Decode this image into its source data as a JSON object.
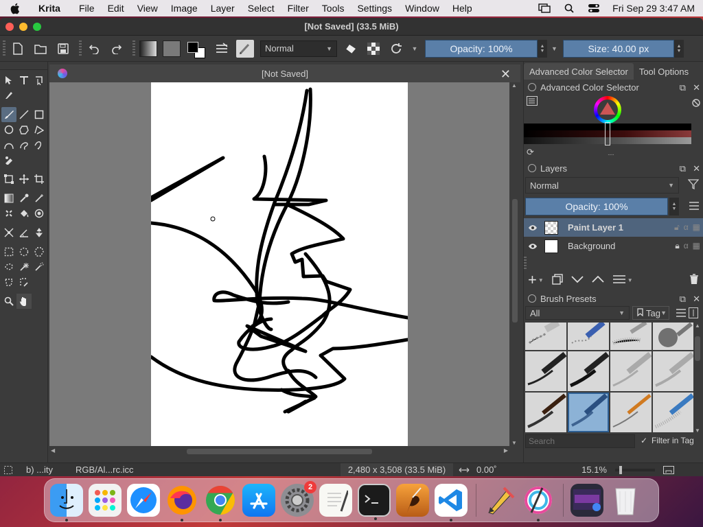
{
  "menubar": {
    "app_name": "Krita",
    "items": [
      "File",
      "Edit",
      "View",
      "Image",
      "Layer",
      "Select",
      "Filter",
      "Tools",
      "Settings",
      "Window",
      "Help"
    ],
    "clock": "Fri Sep 29  3:47 AM"
  },
  "window": {
    "title": "[Not Saved]  (33.5 MiB)"
  },
  "toolbar": {
    "blend_mode": "Normal",
    "opacity": "Opacity: 100%",
    "size": "Size: 40.00 px"
  },
  "document": {
    "tab_title": "[Not Saved]",
    "close": "✕"
  },
  "dock": {
    "tabs": [
      "Advanced Color Selector",
      "Tool Options"
    ],
    "color_selector_title": "Advanced Color Selector",
    "layers_title": "Layers",
    "layers_blend": "Normal",
    "layers_opacity": "Opacity:  100%",
    "layers": [
      {
        "name": "Paint Layer 1",
        "selected": true
      },
      {
        "name": "Background",
        "selected": false
      }
    ],
    "brush_title": "Brush Presets",
    "brush_filter": "All",
    "tag_label": "Tag",
    "search_placeholder": "Search",
    "filter_in_tag": "Filter in Tag"
  },
  "statusbar": {
    "brush": "b) ...ity",
    "color_profile": "RGB/Al...rc.icc",
    "dimensions": "2,480 x 3,508 (33.5 MiB)",
    "rotation": "0.00˚",
    "zoom": "15.1%"
  },
  "dock_apps": {
    "badge_count": "2"
  },
  "colors": {
    "accent": "#5a7fa8",
    "selected_layer": "#4f647d",
    "panel_bg": "#3b3b3b"
  }
}
